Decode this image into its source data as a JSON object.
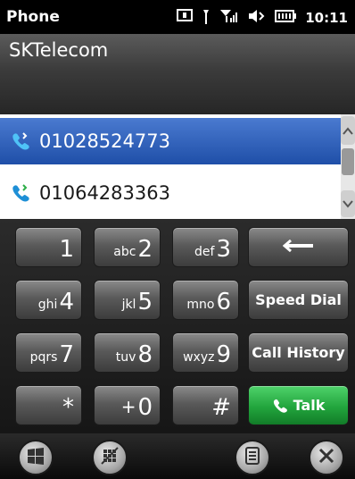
{
  "status": {
    "app_title": "Phone",
    "time": "10:11"
  },
  "carrier": "SKTelecom",
  "numbers": [
    {
      "number": "01028524773",
      "selected": true
    },
    {
      "number": "01064283363",
      "selected": false
    }
  ],
  "keypad": {
    "k1": {
      "sub": "",
      "num": "1"
    },
    "k2": {
      "sub": "abc",
      "num": "2"
    },
    "k3": {
      "sub": "def",
      "num": "3"
    },
    "k4": {
      "sub": "ghi",
      "num": "4"
    },
    "k5": {
      "sub": "jkl",
      "num": "5"
    },
    "k6": {
      "sub": "mno",
      "num": "6"
    },
    "k7": {
      "sub": "pqrs",
      "num": "7"
    },
    "k8": {
      "sub": "tuv",
      "num": "8"
    },
    "k9": {
      "sub": "wxyz",
      "num": "9"
    },
    "kstar": {
      "sub": "",
      "num": "*"
    },
    "k0": {
      "sub": "+",
      "num": "0"
    },
    "khash": {
      "sub": "",
      "num": "#"
    },
    "speed_dial": "Speed Dial",
    "call_history": "Call History",
    "talk": "Talk"
  },
  "colors": {
    "selected_row": "#2a5ab8",
    "talk_green": "#22a53d",
    "phone_icon": "#1e8fd6"
  }
}
